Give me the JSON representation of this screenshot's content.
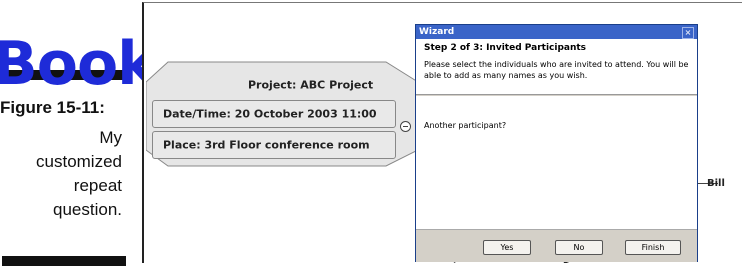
{
  "book_margin": {
    "watermark_text": "Books",
    "figure_label": "Figure 15-11:",
    "caption_lines": [
      "My",
      "customized",
      "repeat",
      "question."
    ]
  },
  "mindmap": {
    "project_label": "Project: ABC Project",
    "date_label": "Date/Time: 20 October 2003 11:00",
    "place_label": "Place: 3rd Floor conference room",
    "right_node_label": "Bill"
  },
  "wizard": {
    "title": "Wizard",
    "close_glyph": "×",
    "step_title": "Step 2 of 3: Invited Participants",
    "description": "Please select the individuals who are invited to attend. You will be able to add as many names as you wish.",
    "question": "Another participant?",
    "buttons": {
      "yes": "Yes",
      "no": "No",
      "finish": "Finish"
    }
  }
}
